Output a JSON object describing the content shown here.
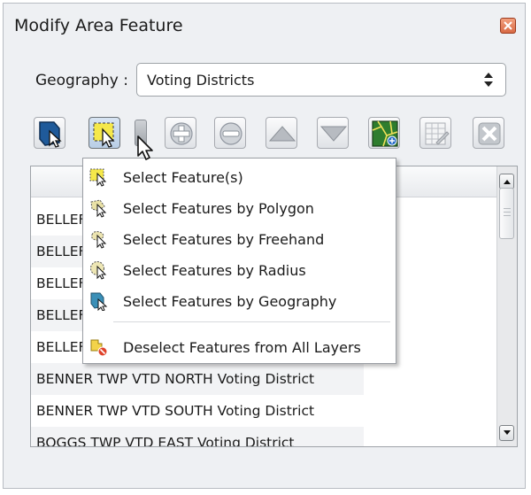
{
  "window": {
    "title": "Modify Area Feature"
  },
  "geography": {
    "label": "Geography :",
    "selected": "Voting Districts"
  },
  "toolbar": {
    "buttons": [
      {
        "name": "select-by-geography-icon"
      },
      {
        "name": "select-features-icon"
      },
      {
        "name": "dropdown-arrow-icon"
      },
      {
        "name": "add-icon"
      },
      {
        "name": "remove-icon"
      },
      {
        "name": "move-up-icon"
      },
      {
        "name": "move-down-icon"
      },
      {
        "name": "map-zoom-icon"
      },
      {
        "name": "attribute-table-icon"
      },
      {
        "name": "delete-icon"
      }
    ]
  },
  "list": {
    "rows": [
      "BELLEFONTE BORO VTD NORTH Voting District",
      "BELLEFONTE BORO VTD NORTHEAST Voting District",
      "BELLEFONTE BORO VTD SOUTH Voting District",
      "BELLEFONTE BORO VTD SOUTHEAST Voting District",
      "BELLEFONTE BORO VTD WEST Voting District",
      "BENNER TWP VTD NORTH Voting District",
      "BENNER TWP VTD SOUTH Voting District",
      "BOGGS TWP VTD EAST Voting District"
    ]
  },
  "menu": {
    "items": [
      {
        "label": "Select Feature(s)",
        "icon": "select-features-icon"
      },
      {
        "label": "Select Features by Polygon",
        "icon": "select-polygon-icon"
      },
      {
        "label": "Select Features by Freehand",
        "icon": "select-freehand-icon"
      },
      {
        "label": "Select Features by Radius",
        "icon": "select-radius-icon"
      },
      {
        "label": "Select Features by Geography",
        "icon": "select-geography-icon"
      },
      {
        "label": "Deselect Features from All Layers",
        "icon": "deselect-all-icon"
      }
    ]
  }
}
